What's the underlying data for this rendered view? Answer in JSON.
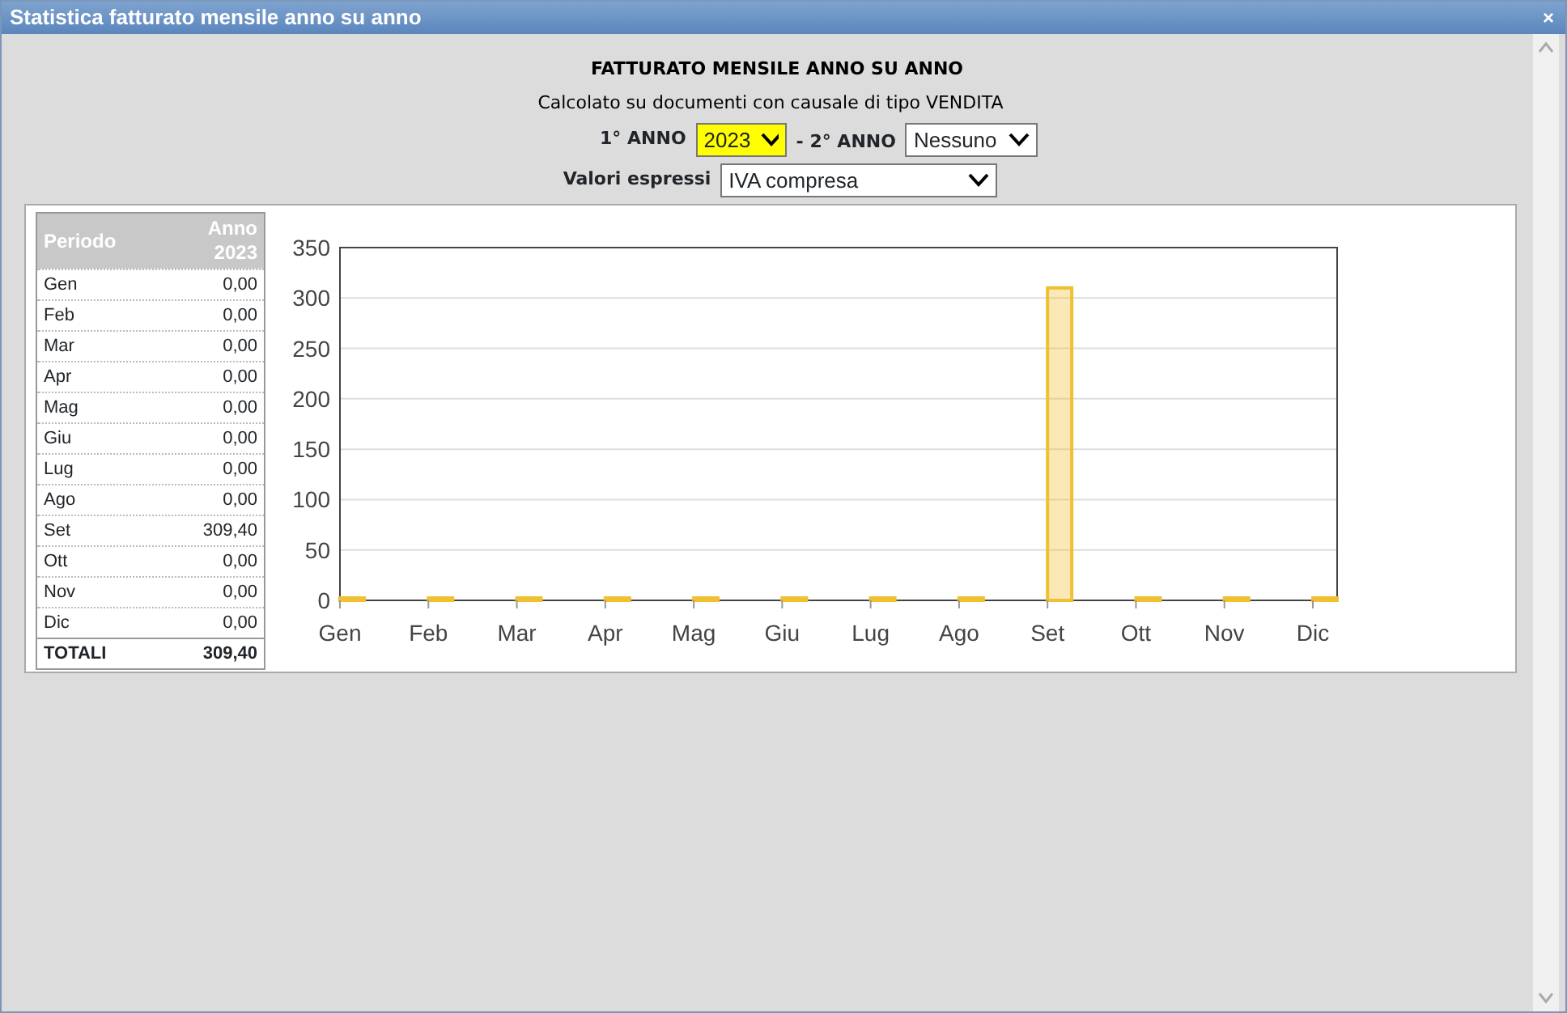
{
  "window": {
    "title": "Statistica fatturato mensile anno su anno",
    "close": "×"
  },
  "header": {
    "title": "FATTURATO MENSILE ANNO SU ANNO",
    "subtitle": "Calcolato su documenti con causale di tipo VENDITA"
  },
  "filters": [
    {
      "label": "1° ANNO",
      "value": "2023",
      "highlighted": true
    },
    {
      "label": "- 2° ANNO",
      "value": "Nessuno",
      "highlighted": false
    }
  ],
  "values_filter": {
    "label": "Valori espressi",
    "value": "IVA compresa"
  },
  "table": {
    "columns": [
      "Periodo",
      "Anno 2023"
    ],
    "rows": [
      [
        "Gen",
        "0,00"
      ],
      [
        "Feb",
        "0,00"
      ],
      [
        "Mar",
        "0,00"
      ],
      [
        "Apr",
        "0,00"
      ],
      [
        "Mag",
        "0,00"
      ],
      [
        "Giu",
        "0,00"
      ],
      [
        "Lug",
        "0,00"
      ],
      [
        "Ago",
        "0,00"
      ],
      [
        "Set",
        "309,40"
      ],
      [
        "Ott",
        "0,00"
      ],
      [
        "Nov",
        "0,00"
      ],
      [
        "Dic",
        "0,00"
      ]
    ],
    "total": [
      "TOTALI",
      "309,40"
    ]
  },
  "chart_data": {
    "type": "bar",
    "categories": [
      "Gen",
      "Feb",
      "Mar",
      "Apr",
      "Mag",
      "Giu",
      "Lug",
      "Ago",
      "Set",
      "Ott",
      "Nov",
      "Dic"
    ],
    "series": [
      {
        "color": "#f0c030",
        "values": [
          0,
          0,
          0,
          0,
          0,
          0,
          0,
          0,
          310,
          0,
          0,
          0
        ]
      }
    ],
    "grid": true,
    "ylim": [
      0,
      350
    ],
    "yticks": [
      0,
      50,
      100,
      150,
      200,
      250,
      300,
      350
    ]
  }
}
